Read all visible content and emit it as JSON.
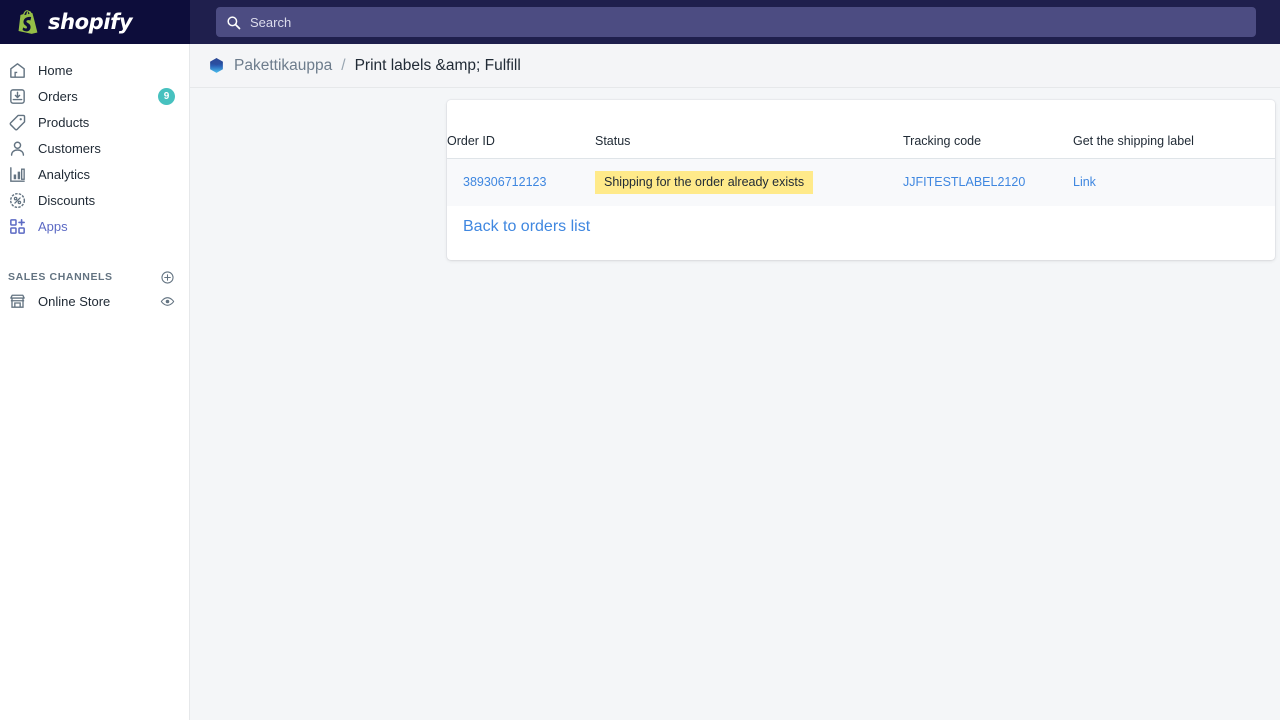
{
  "topbar": {
    "logo_text": "shopify",
    "logo_icon": "shopify-bag-icon",
    "search_placeholder": "Search",
    "search_value": "",
    "search_icon": "search-icon"
  },
  "sidebar": {
    "items": [
      {
        "label": "Home",
        "icon": "home-icon",
        "badge": "",
        "active": false
      },
      {
        "label": "Orders",
        "icon": "orders-icon",
        "badge": "9",
        "active": false
      },
      {
        "label": "Products",
        "icon": "products-tag-icon",
        "badge": "",
        "active": false
      },
      {
        "label": "Customers",
        "icon": "customers-person-icon",
        "badge": "",
        "active": false
      },
      {
        "label": "Analytics",
        "icon": "analytics-bars-icon",
        "badge": "",
        "active": false
      },
      {
        "label": "Discounts",
        "icon": "discounts-percent-icon",
        "badge": "",
        "active": false
      },
      {
        "label": "Apps",
        "icon": "apps-grid-plus-icon",
        "badge": "",
        "active": true
      }
    ],
    "section": {
      "title": "SALES CHANNELS",
      "add_icon": "plus-circle-icon",
      "channels": [
        {
          "label": "Online Store",
          "icon": "storefront-icon",
          "action_icon": "eye-icon"
        }
      ]
    }
  },
  "breadcrumb": {
    "app_icon": "app-cube-icon",
    "app_name": "Pakettikauppa",
    "separator": "/",
    "page_title": "Print labels &amp; Fulfill"
  },
  "table": {
    "columns": [
      "Order ID",
      "Status",
      "Tracking code",
      "Get the shipping label"
    ],
    "rows": [
      {
        "order_id": "389306712123",
        "status": "Shipping for the order already exists",
        "tracking_code": "JJFITESTLABEL2120",
        "label_link": "Link"
      }
    ],
    "back_link": "Back to orders list"
  },
  "colors": {
    "topbar": "#1f1f4d",
    "logo_zone": "#0d0d3b",
    "search_field": "#4c4c82",
    "page_background": "#f4f6f8",
    "accent_active": "#5c6ac4",
    "badge_teal": "#47c1bf",
    "status_yellow": "#ffea8a",
    "link_blue": "#3f87e0"
  }
}
